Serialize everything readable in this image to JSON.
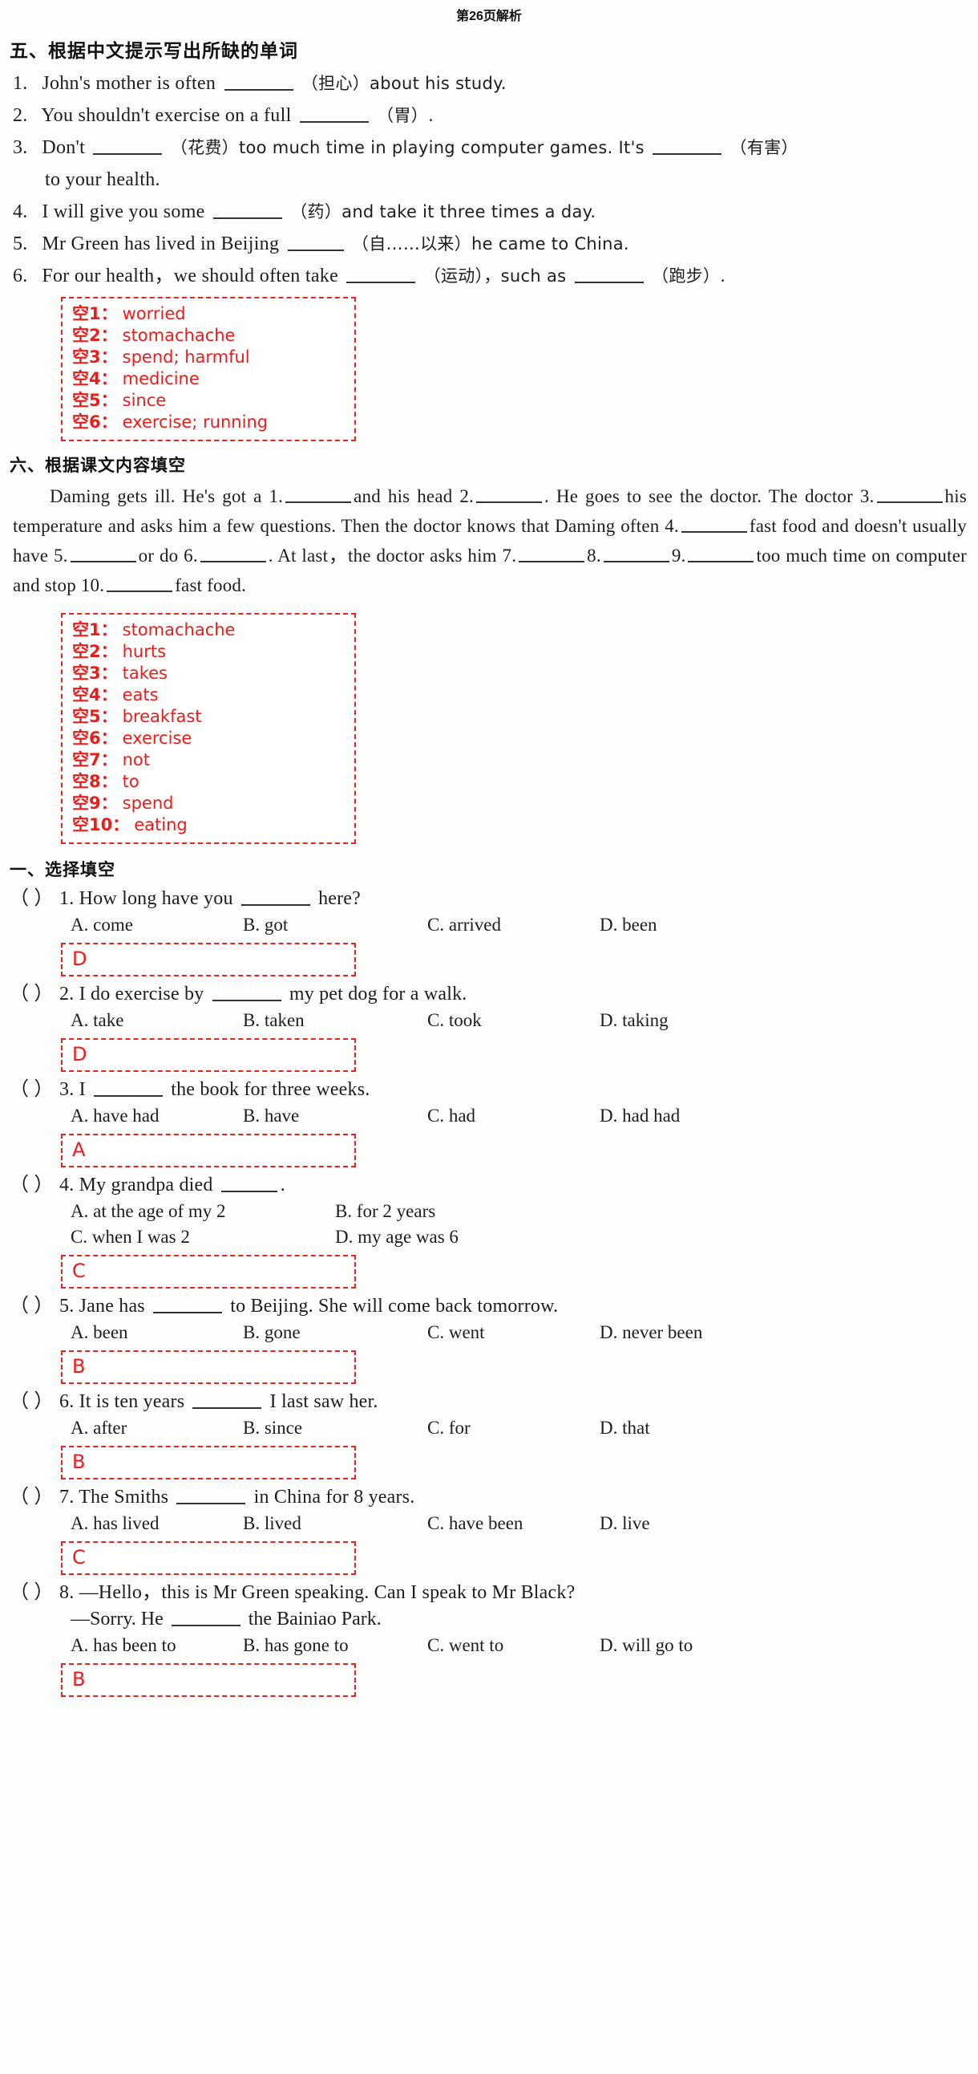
{
  "page": {
    "title": "第26页解析"
  },
  "section_five": {
    "heading": "五、根据中文提示写出所缺的单词",
    "items": [
      {
        "num": "1.",
        "pre": "John's mother is often",
        "post": "（担心）about his study."
      },
      {
        "num": "2.",
        "pre": "You shouldn't exercise on a full",
        "post": "（胃）."
      },
      {
        "num": "3.",
        "pre": "Don't",
        "mid": "（花费）too much time in playing computer games. It's",
        "post": "（有害）",
        "cont": "to your health."
      },
      {
        "num": "4.",
        "pre": "I will give you some",
        "post": "（药）and take it three times a day."
      },
      {
        "num": "5.",
        "pre": "Mr Green has lived in Beijing",
        "post": "（自……以来）he came to China."
      },
      {
        "num": "6.",
        "pre": "For our health，we should often take",
        "mid": "（运动），such as",
        "post": "（跑步）."
      }
    ],
    "answers": [
      {
        "key": "空1：",
        "value": "worried"
      },
      {
        "key": "空2：",
        "value": "stomachache"
      },
      {
        "key": "空3：",
        "value": "spend; harmful"
      },
      {
        "key": "空4：",
        "value": "medicine"
      },
      {
        "key": "空5：",
        "value": "since"
      },
      {
        "key": "空6：",
        "value": "exercise; running"
      }
    ]
  },
  "section_six": {
    "heading": "六、根据课文内容填空",
    "paragraph": {
      "p1": "Daming gets ill. He's got a 1.",
      "p2": "and his head 2.",
      "p3": ". He goes to see the doctor. The doctor 3.",
      "p4": "his temperature and asks him a few questions. Then the doctor knows that Daming often 4.",
      "p5": "fast food and doesn't usually have 5.",
      "p6": "or do 6.",
      "p7": ". At last，the doctor asks him 7.",
      "p8": "8.",
      "p9": "9.",
      "p10": "too much time on computer and stop 10.",
      "p11": "fast food."
    },
    "answers": [
      {
        "key": "空1：",
        "value": "stomachache"
      },
      {
        "key": "空2：",
        "value": "hurts"
      },
      {
        "key": "空3：",
        "value": "takes"
      },
      {
        "key": "空4：",
        "value": "eats"
      },
      {
        "key": "空5：",
        "value": "breakfast"
      },
      {
        "key": "空6：",
        "value": "exercise"
      },
      {
        "key": "空7：",
        "value": "not"
      },
      {
        "key": "空8：",
        "value": "to"
      },
      {
        "key": "空9：",
        "value": "spend"
      },
      {
        "key": "空10：",
        "value": "eating"
      }
    ]
  },
  "section_one": {
    "heading": "一、选择填空",
    "questions": [
      {
        "paren": "（      ）",
        "num": "1.",
        "pre": "How long have you",
        "post": "here?",
        "options": [
          "A. come",
          "B. got",
          "C. arrived",
          "D. been"
        ],
        "answer": "D"
      },
      {
        "paren": "（      ）",
        "num": "2.",
        "pre": "I do exercise by",
        "post": "my pet dog for a walk.",
        "options": [
          "A. take",
          "B. taken",
          "C. took",
          "D. taking"
        ],
        "answer": "D"
      },
      {
        "paren": "（      ）",
        "num": "3.",
        "pre": "I",
        "post": "the book for three weeks.",
        "options": [
          "A. have had",
          "B. have",
          "C. had",
          "D. had had"
        ],
        "answer": "A"
      },
      {
        "paren": "（      ）",
        "num": "4.",
        "pre": "My grandpa died",
        "post": ".",
        "options_two_rows": [
          [
            "A. at the age of my 2",
            "B. for 2 years"
          ],
          [
            "C. when I was 2",
            "D. my age was 6"
          ]
        ],
        "answer": "C"
      },
      {
        "paren": "（      ）",
        "num": "5.",
        "pre": "Jane has",
        "post": "to Beijing. She will come back tomorrow.",
        "options": [
          "A. been",
          "B. gone",
          "C. went",
          "D. never been"
        ],
        "answer": "B"
      },
      {
        "paren": "（      ）",
        "num": "6.",
        "pre": "It is ten years",
        "post": "I last saw her.",
        "options": [
          "A. after",
          "B. since",
          "C. for",
          "D. that"
        ],
        "answer": "B"
      },
      {
        "paren": "（      ）",
        "num": "7.",
        "pre": "The Smiths",
        "post": "in China for 8 years.",
        "options": [
          "A. has lived",
          "B. lived",
          "C. have been",
          "D. live"
        ],
        "answer": "C"
      },
      {
        "paren": "（      ）",
        "num": "8.",
        "line1": "—Hello，this is Mr Green speaking. Can I speak to Mr Black?",
        "line2_pre": "—Sorry. He",
        "line2_post": "the Bainiao Park.",
        "options": [
          "A. has been to",
          "B. has gone to",
          "C. went to",
          "D. will go to"
        ],
        "answer": "B"
      }
    ]
  },
  "colors": {
    "answer_red": "#ec1c19",
    "box_border": "#e8231e",
    "text": "#1d1d1d"
  }
}
